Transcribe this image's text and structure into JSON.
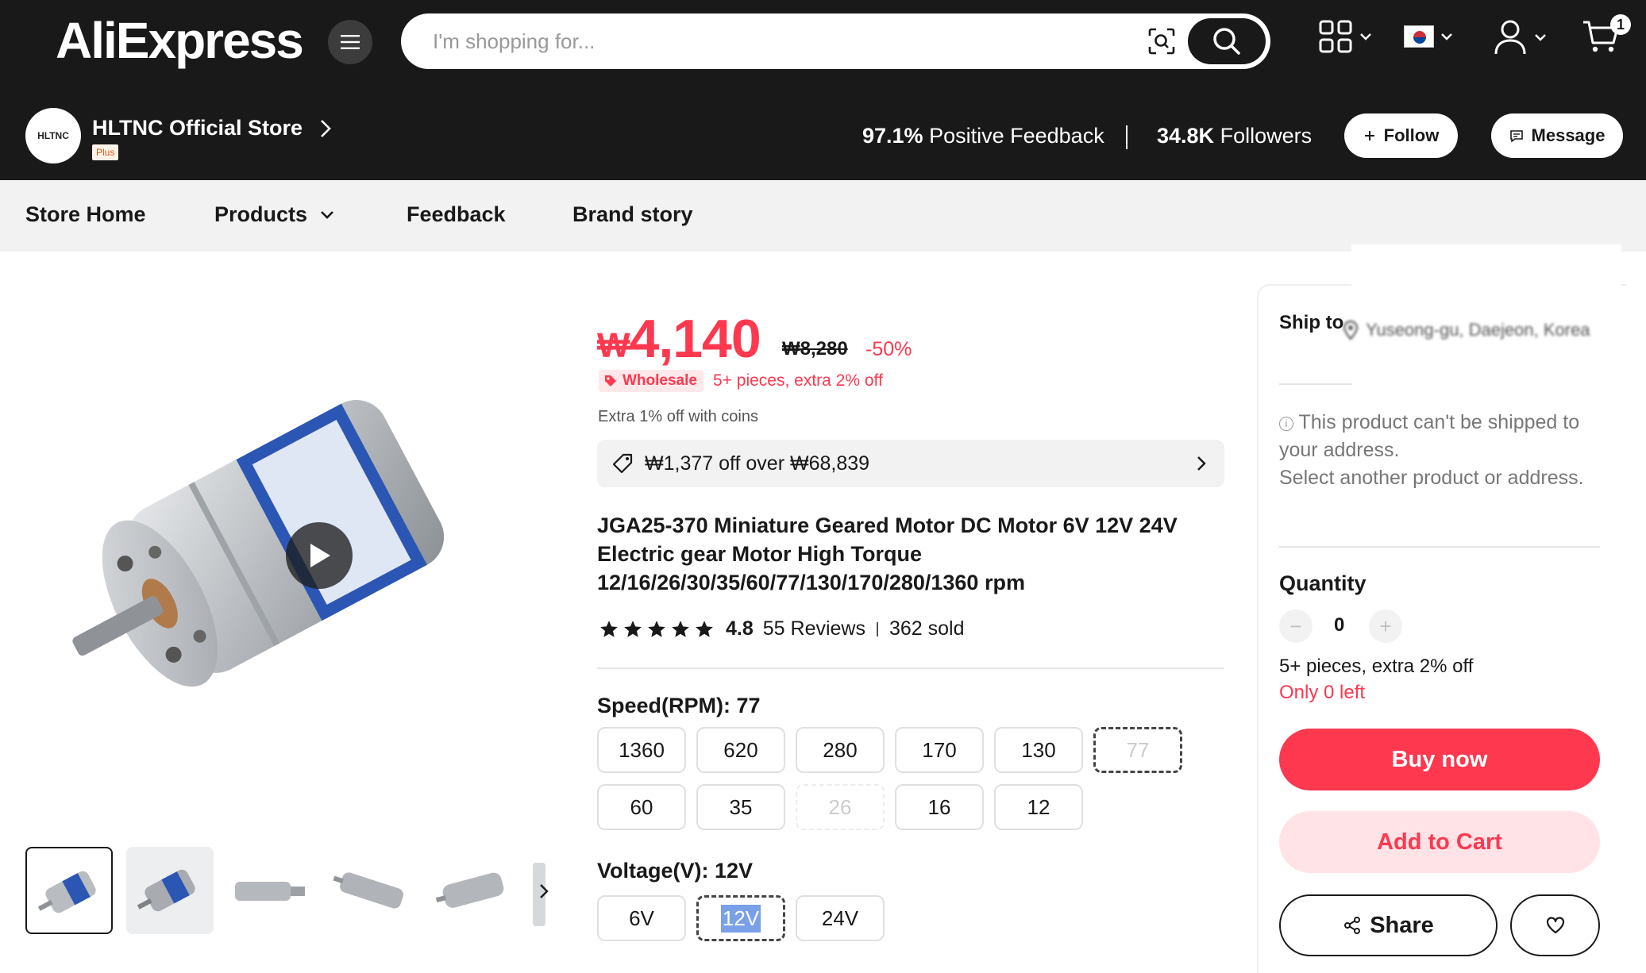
{
  "header": {
    "logo": "AliExpress",
    "search_placeholder": "I'm shopping for...",
    "cart_count": "1"
  },
  "store": {
    "name": "HLTNC Official Store",
    "logo_text": "HLTNC",
    "badge": "Plus",
    "feedback_value": "97.1%",
    "feedback_label": "Positive Feedback",
    "followers_value": "34.8K",
    "followers_label": "Followers",
    "follow_label": "Follow",
    "message_label": "Message"
  },
  "nav": {
    "store_home": "Store Home",
    "products": "Products",
    "feedback": "Feedback",
    "brand_story": "Brand story"
  },
  "product": {
    "price": "4,140",
    "currency": "₩",
    "old_price": "₩8,280",
    "discount": "-50%",
    "wholesale_tag": "Wholesale",
    "wholesale_text": "5+ pieces, extra 2% off",
    "coins_text": "Extra 1% off with coins",
    "coupon_text": "₩1,377 off over ₩68,839",
    "title": "JGA25-370 Miniature Geared Motor DC Motor 6V 12V 24V Electric gear Motor High Torque 12/16/26/30/35/60/77/130/170/280/1360 rpm",
    "rating": "4.8",
    "reviews": "55 Reviews",
    "sold": "362 sold",
    "star_count": 5,
    "speed_label": "Speed(RPM): 77",
    "speed_options": [
      {
        "label": "1360",
        "state": "normal"
      },
      {
        "label": "620",
        "state": "normal"
      },
      {
        "label": "280",
        "state": "normal"
      },
      {
        "label": "170",
        "state": "normal"
      },
      {
        "label": "130",
        "state": "normal"
      },
      {
        "label": "77",
        "state": "selected-disabled"
      },
      {
        "label": "60",
        "state": "normal"
      },
      {
        "label": "35",
        "state": "normal"
      },
      {
        "label": "26",
        "state": "disabled"
      },
      {
        "label": "16",
        "state": "normal"
      },
      {
        "label": "12",
        "state": "normal"
      }
    ],
    "voltage_label": "Voltage(V): 12V",
    "voltage_options": [
      {
        "label": "6V",
        "state": "normal"
      },
      {
        "label": "12V",
        "state": "selected"
      },
      {
        "label": "24V",
        "state": "normal"
      }
    ]
  },
  "panel": {
    "ship_label": "Ship to",
    "ship_address": "Yuseong-gu, Daejeon, Korea",
    "warning_line1": "This product can't be shipped to your address.",
    "warning_line2": "Select another product or address.",
    "quantity_label": "Quantity",
    "quantity_value": "0",
    "qty_minus": "−",
    "qty_plus": "+",
    "wholesale_text": "5+ pieces, extra 2% off",
    "stock_text": "Only 0 left",
    "buy_now": "Buy now",
    "add_to_cart": "Add to Cart",
    "share": "Share"
  },
  "colors": {
    "accent": "#fd384f",
    "header_bg": "#191919",
    "nav_bg": "#f2f2f2"
  }
}
